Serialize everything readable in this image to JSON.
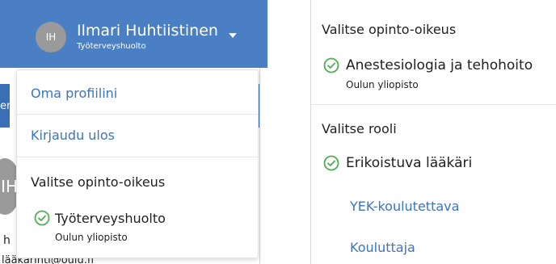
{
  "header": {
    "avatar_initials": "IH",
    "user_name": "Ilmari Huhtiistinen",
    "user_org": "Työterveyshuolto",
    "background_color": "#4a7fc4"
  },
  "background_page": {
    "avatar_initials": "IH",
    "text_fragment_1": "h",
    "text_fragment_2": "lääkärinti@oulu.fi",
    "tab_fragment": "en"
  },
  "dropdown": {
    "menu": [
      {
        "label": "Oma profiilini"
      },
      {
        "label": "Kirjaudu ulos"
      }
    ],
    "section_heading": "Valitse opinto-oikeus",
    "selected_option": {
      "label": "Työterveyshuolto",
      "sublabel": "Oulun yliopisto",
      "icon": "check-circle-icon"
    }
  },
  "right_panel": {
    "study_rights_heading": "Valitse opinto-oikeus",
    "selected_study_right": {
      "label": "Anestesiologia ja tehohoito",
      "sublabel": "Oulun yliopisto",
      "icon": "check-circle-icon"
    },
    "roles_heading": "Valitse rooli",
    "roles": [
      {
        "label": "Erikoistuva lääkäri",
        "selected": true
      },
      {
        "label": "YEK-koulutettava",
        "selected": false
      },
      {
        "label": "Kouluttaja",
        "selected": false
      }
    ]
  },
  "colors": {
    "link": "#3b74c0",
    "check_green": "#4caf50",
    "text": "#1f1f1f"
  }
}
